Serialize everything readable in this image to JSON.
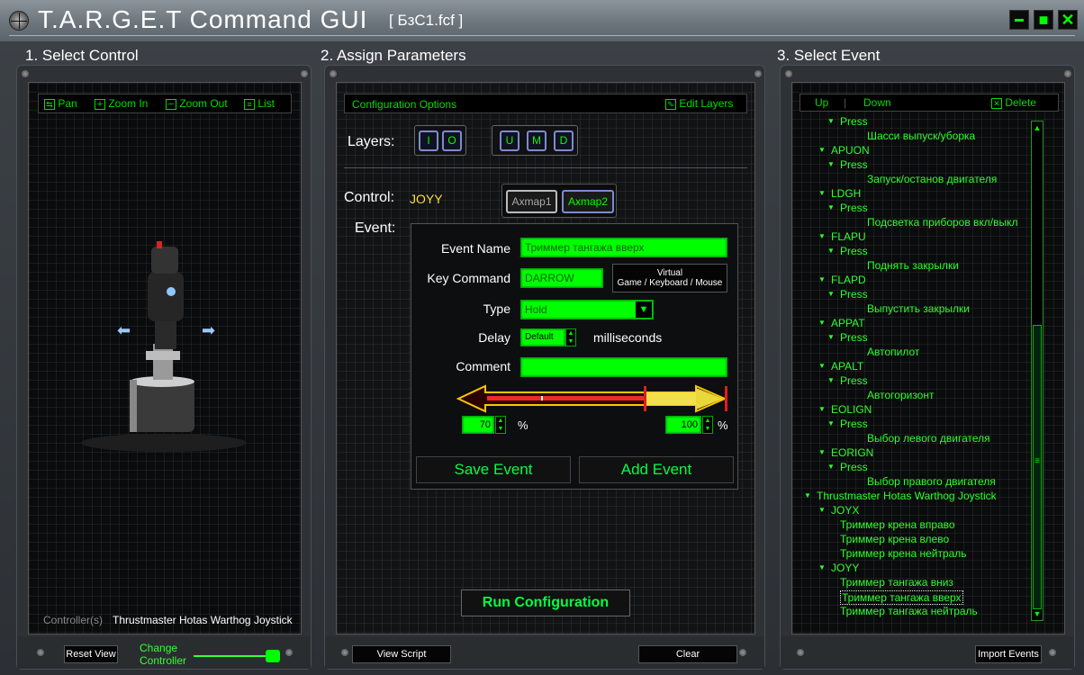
{
  "window": {
    "title": "T.A.R.G.E.T Command GUI",
    "file": "[ БзС1.fcf ]",
    "minimize_glyph": "▬",
    "maximize_glyph": "■",
    "close_glyph": "✕"
  },
  "sections": {
    "s1": "1. Select Control",
    "s2": "2. Assign Parameters",
    "s3": "3. Select Event"
  },
  "left": {
    "toolbar": {
      "pan": "Pan",
      "zoom_in": "Zoom In",
      "zoom_out": "Zoom Out",
      "list": "List"
    },
    "controllers_label": "Controller(s)",
    "controller_name": "Thrustmaster Hotas Warthog Joystick",
    "reset_view": "Reset View",
    "change_controller": "Change Controller",
    "controller_slider": 1.0
  },
  "middle": {
    "config_options": "Configuration Options",
    "edit_layers": "Edit Layers",
    "layers_label": "Layers:",
    "layers_group1": [
      "I",
      "O"
    ],
    "layers_group2": [
      "U",
      "M",
      "D"
    ],
    "control_label": "Control:",
    "control_value": "JOYY",
    "axmap1": "Axmap1",
    "axmap2": "Axmap2",
    "event_label": "Event:",
    "event_name_label": "Event Name",
    "event_name_value": "Триммер тангажа вверх",
    "key_command_label": "Key Command",
    "key_command_value": "DARROW",
    "virtual_btn_line1": "Virtual",
    "virtual_btn_line2": "Game / Keyboard / Mouse",
    "type_label": "Type",
    "type_value": "Hold",
    "delay_label": "Delay",
    "delay_value": "Default",
    "delay_unit": "milliseconds",
    "comment_label": "Comment",
    "comment_value": "",
    "range_low": "70",
    "range_high": "100",
    "percent": "%",
    "save_event": "Save Event",
    "add_event": "Add Event",
    "run_config": "Run Configuration",
    "view_script": "View Script",
    "clear": "Clear"
  },
  "right": {
    "toolbar": {
      "up": "Up",
      "down": "Down",
      "delete": "Delete"
    },
    "tree": [
      {
        "text": "Press",
        "level": 2,
        "arrow": true
      },
      {
        "text": "Шасси выпуск/уборка",
        "level": 3,
        "arrow": false
      },
      {
        "text": "APUON",
        "level": 1,
        "arrow": true
      },
      {
        "text": "Press",
        "level": 2,
        "arrow": true
      },
      {
        "text": "Запуск/останов двигателя",
        "level": 3,
        "arrow": false
      },
      {
        "text": "LDGH",
        "level": 1,
        "arrow": true
      },
      {
        "text": "Press",
        "level": 2,
        "arrow": true
      },
      {
        "text": "Подсветка приборов вкл/выкл",
        "level": 3,
        "arrow": false
      },
      {
        "text": "FLAPU",
        "level": 1,
        "arrow": true
      },
      {
        "text": "Press",
        "level": 2,
        "arrow": true
      },
      {
        "text": "Поднять закрылки",
        "level": 3,
        "arrow": false
      },
      {
        "text": "FLAPD",
        "level": 1,
        "arrow": true
      },
      {
        "text": "Press",
        "level": 2,
        "arrow": true
      },
      {
        "text": "Выпустить закрылки",
        "level": 3,
        "arrow": false
      },
      {
        "text": "APPAT",
        "level": 1,
        "arrow": true
      },
      {
        "text": "Press",
        "level": 2,
        "arrow": true
      },
      {
        "text": "Автопилот",
        "level": 3,
        "arrow": false
      },
      {
        "text": "APALT",
        "level": 1,
        "arrow": true
      },
      {
        "text": "Press",
        "level": 2,
        "arrow": true
      },
      {
        "text": "Автогоризонт",
        "level": 3,
        "arrow": false
      },
      {
        "text": "EOLIGN",
        "level": 1,
        "arrow": true
      },
      {
        "text": "Press",
        "level": 2,
        "arrow": true
      },
      {
        "text": "Выбор левого двигателя",
        "level": 3,
        "arrow": false
      },
      {
        "text": "EORIGN",
        "level": 1,
        "arrow": true
      },
      {
        "text": "Press",
        "level": 2,
        "arrow": true
      },
      {
        "text": "Выбор правого двигателя",
        "level": 3,
        "arrow": false
      },
      {
        "text": "Thrustmaster Hotas Warthog Joystick",
        "level": 0,
        "arrow": true
      },
      {
        "text": "JOYX",
        "level": 1,
        "arrow": true
      },
      {
        "text": "Триммер крена вправо",
        "level": 2,
        "arrow": false
      },
      {
        "text": "Триммер крена влево",
        "level": 2,
        "arrow": false
      },
      {
        "text": "Триммер крена нейтраль",
        "level": 2,
        "arrow": false
      },
      {
        "text": "JOYY",
        "level": 1,
        "arrow": true
      },
      {
        "text": "Триммер тангажа вниз",
        "level": 2,
        "arrow": false
      },
      {
        "text": "Триммер тангажа вверх",
        "level": 2,
        "arrow": false,
        "selected": true
      },
      {
        "text": "Триммер тангажа нейтраль",
        "level": 2,
        "arrow": false
      }
    ],
    "import_events": "Import Events"
  }
}
